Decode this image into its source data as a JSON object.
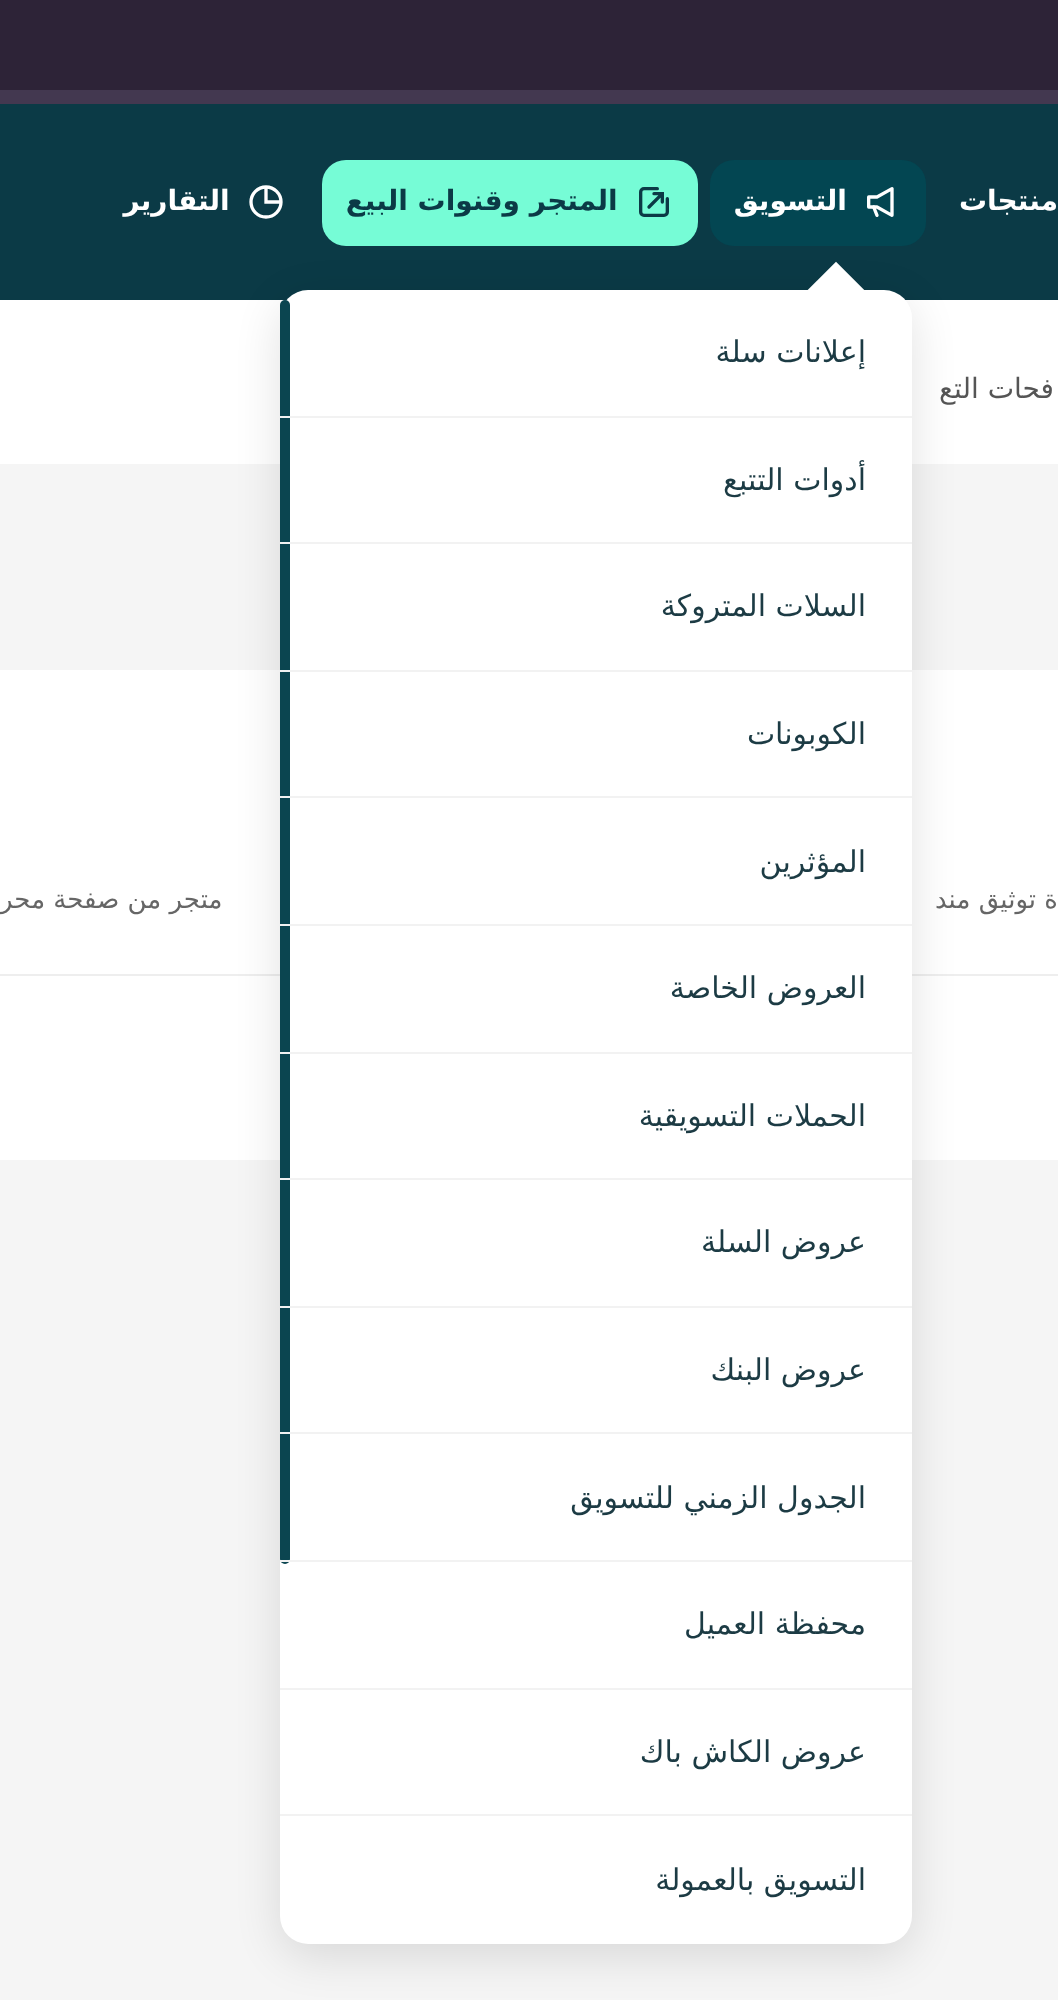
{
  "nav": {
    "items": [
      {
        "label": "منتجات",
        "kind": "plain",
        "selected": false,
        "expanded": false
      },
      {
        "label": "التسويق",
        "kind": "megaphone",
        "selected": false,
        "expanded": true
      },
      {
        "label": "المتجر وقنوات البيع",
        "kind": "store",
        "selected": true,
        "expanded": false
      },
      {
        "label": "التقارير",
        "kind": "reports",
        "selected": false,
        "expanded": false
      }
    ]
  },
  "page": {
    "tab_text": "فحات التع",
    "card_text_right": "ة توثيق مند",
    "card_text_left": "متجر من صفحة محر"
  },
  "menu": {
    "items": [
      {
        "label": "إعلانات سلة"
      },
      {
        "label": "أدوات التتبع"
      },
      {
        "label": "السلات المتروكة"
      },
      {
        "label": "الكوبونات"
      },
      {
        "label": "المؤثرين"
      },
      {
        "label": "العروض الخاصة"
      },
      {
        "label": "الحملات التسويقية"
      },
      {
        "label": "عروض السلة"
      },
      {
        "label": "عروض البنك"
      },
      {
        "label": "الجدول الزمني للتسويق"
      },
      {
        "label": "محفظة العميل"
      },
      {
        "label": "عروض الكاش باك"
      },
      {
        "label": "التسويق بالعمولة"
      }
    ]
  }
}
